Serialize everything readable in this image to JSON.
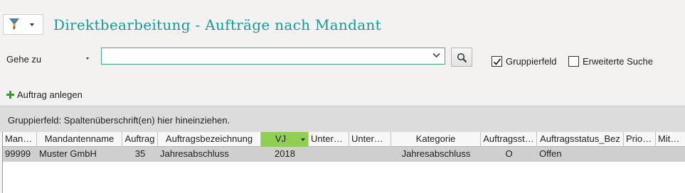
{
  "title": "Direktbearbeitung - Aufträge nach Mandant",
  "goto": {
    "label": "Gehe zu",
    "value": ""
  },
  "options": {
    "group_field_label": "Gruppierfeld",
    "group_field_checked": true,
    "extended_search_label": "Erweiterte Suche",
    "extended_search_checked": false
  },
  "create_order_label": "Auftrag anlegen",
  "group_panel_text": "Gruppierfeld: Spaltenüberschrift(en) hier hineinziehen.",
  "colors": {
    "title": "#169a94",
    "sorted_header": "#8fcf54",
    "selected_row": "#cfcfcf",
    "plus": "#3a9a2f"
  },
  "grid": {
    "columns": [
      {
        "key": "mandant",
        "label": "Mand…"
      },
      {
        "key": "mandantenname",
        "label": "Mandantenname"
      },
      {
        "key": "auftrag",
        "label": "Auftrag"
      },
      {
        "key": "auftragsbezeichnung",
        "label": "Auftragsbezeichnung"
      },
      {
        "key": "vj",
        "label": "VJ",
        "sorted": true
      },
      {
        "key": "unterauftrag1",
        "label": "Untera…"
      },
      {
        "key": "unterauftrag2",
        "label": "Unterau…"
      },
      {
        "key": "kategorie",
        "label": "Kategorie"
      },
      {
        "key": "auftragsstatus",
        "label": "Auftragsst…"
      },
      {
        "key": "auftragsstatus_bez",
        "label": "Auftragsstatus_Bez"
      },
      {
        "key": "prioritaet",
        "label": "Priori…"
      },
      {
        "key": "mitarbeiter",
        "label": "Mitar…"
      }
    ],
    "rows": [
      [
        "99999",
        "Muster GmbH",
        "35",
        "Jahresabschluss",
        "2018",
        "",
        "",
        "Jahresabschluss",
        "O",
        "Offen",
        "",
        ""
      ]
    ]
  }
}
